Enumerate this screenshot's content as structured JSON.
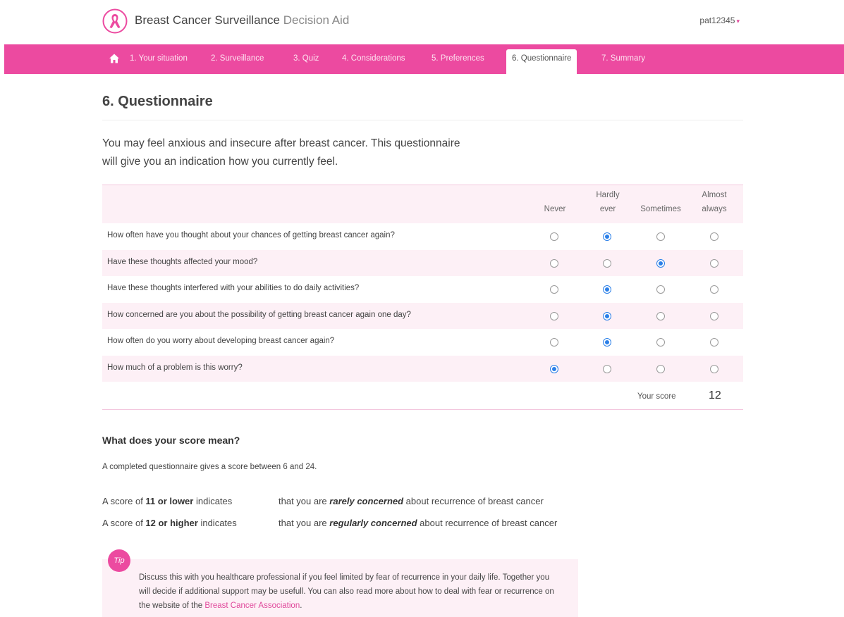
{
  "header": {
    "title_main": "Breast Cancer Surveillance",
    "title_sub": "Decision Aid",
    "user": "pat12345",
    "logo_icon": "pink-ribbon-icon"
  },
  "nav": {
    "home_icon": "home-icon",
    "items": [
      {
        "label": "1. Your situation"
      },
      {
        "label": "2. Surveillance"
      },
      {
        "label": "3. Quiz"
      },
      {
        "label": "4. Considerations"
      },
      {
        "label": "5. Preferences"
      },
      {
        "label": "6. Questionnaire",
        "active": true
      },
      {
        "label": "7. Summary"
      }
    ]
  },
  "page": {
    "title": "6. Questionnaire",
    "intro_line1": "You may feel anxious and insecure after breast cancer. This questionnaire",
    "intro_line2": "will give you an indication how you currently feel."
  },
  "questionnaire": {
    "columns": [
      {
        "line1": "",
        "line2": "Never"
      },
      {
        "line1": "Hardly",
        "line2": "ever"
      },
      {
        "line1": "",
        "line2": "Sometimes"
      },
      {
        "line1": "Almost",
        "line2": "always"
      }
    ],
    "questions": [
      {
        "text": "How often have you thought about your chances of getting breast cancer again?",
        "selected": 1
      },
      {
        "text": "Have these thoughts affected your mood?",
        "selected": 2
      },
      {
        "text": "Have these thoughts interfered with your abilities to do daily activities?",
        "selected": 1
      },
      {
        "text": "How concerned are you about the possibility of getting breast cancer again one day?",
        "selected": 1
      },
      {
        "text": "How often do you worry about developing breast cancer again?",
        "selected": 1
      },
      {
        "text": "How much of a problem is this worry?",
        "selected": 0
      }
    ],
    "score_label": "Your score",
    "score_value": "12"
  },
  "meaning": {
    "title": "What does your score mean?",
    "description": "A completed questionnaire gives a score between 6 and 24.",
    "line1": {
      "pre": "A score of ",
      "bold": "11 or lower",
      "post": " indicates",
      "r_pre": "that you are ",
      "r_em": "rarely concerned",
      "r_post": " about recurrence of breast cancer"
    },
    "line2": {
      "pre": "A score of ",
      "bold": "12 or higher",
      "post": " indicates",
      "r_pre": "that you are ",
      "r_em": "regularly concerned",
      "r_post": " about recurrence of breast cancer"
    }
  },
  "tip": {
    "badge": "Tip",
    "text": "Discuss this with you healthcare professional if you feel limited by fear of recurrence in your daily life. Together you will decide if additional support may be usefull. You can also read more about how to deal with fear or recurrence on the website of the ",
    "link": "Breast Cancer Association",
    "end": "."
  },
  "colors": {
    "brand_pink": "#ec4aa0",
    "row_alt": "#fdf0f6",
    "radio_checked": "#2a7fe8"
  }
}
